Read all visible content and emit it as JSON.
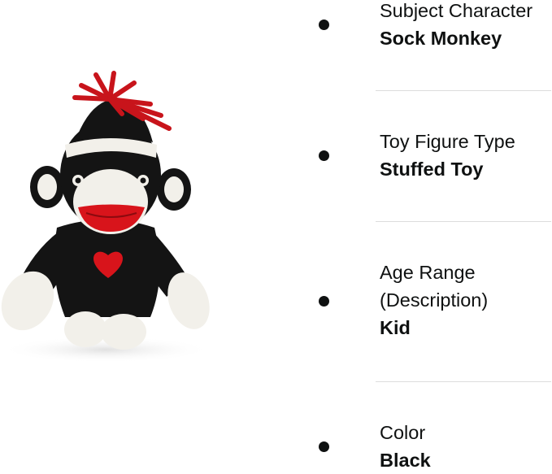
{
  "product": {
    "image_alt": "Sock Monkey plush toy"
  },
  "attributes": [
    {
      "label": "Subject Character",
      "value": "Sock Monkey"
    },
    {
      "label": "Toy Figure Type",
      "value": "Stuffed Toy"
    },
    {
      "label": "Age Range (Description)",
      "label_lines": [
        "Age Range",
        "(Description)"
      ],
      "value": "Kid"
    },
    {
      "label": "Color",
      "value": "Black"
    }
  ],
  "colors": {
    "text": "#0f1111",
    "divider": "#dcdcdc",
    "toy_body": "#141414",
    "toy_trim": "#f2f0ea",
    "toy_mouth": "#d8141b",
    "toy_yarn": "#c8141b"
  }
}
